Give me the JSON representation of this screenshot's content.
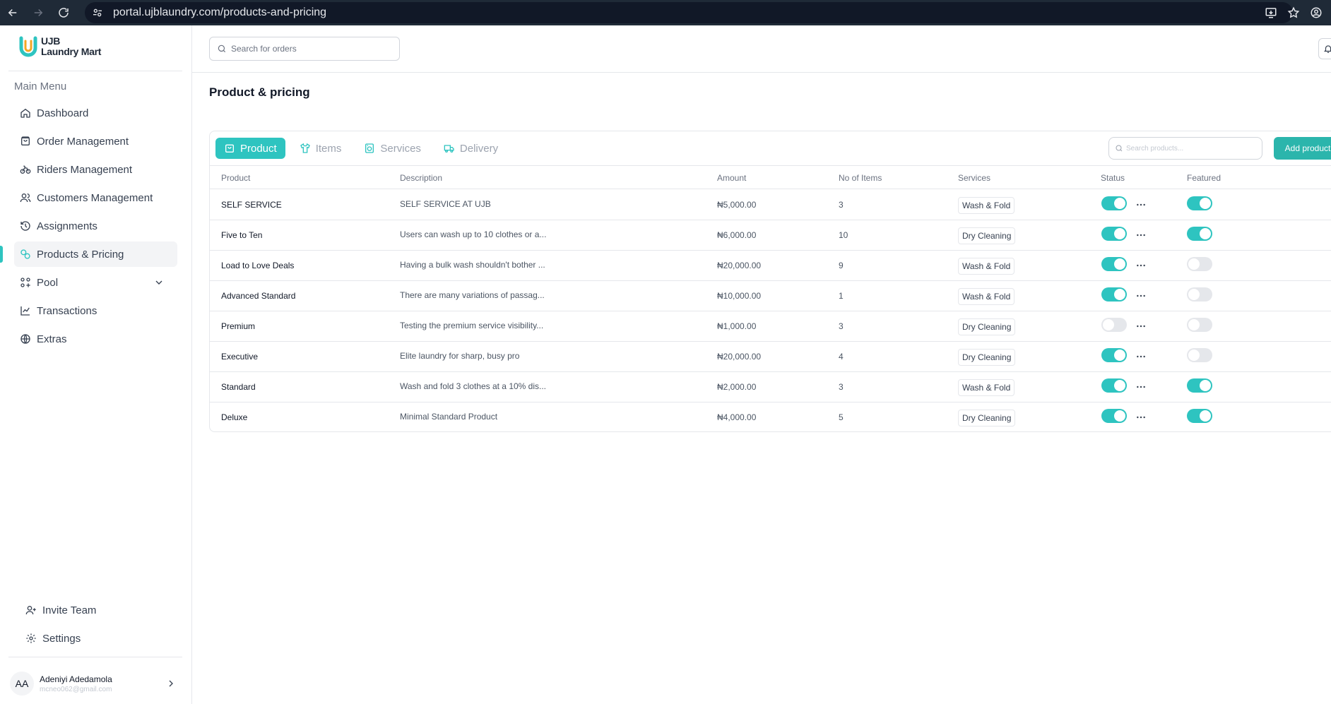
{
  "browser": {
    "url": "portal.ujblaundry.com/products-and-pricing"
  },
  "brand": {
    "line1": "UJB",
    "line2": "Laundry Mart",
    "accent": "#2ec4c0"
  },
  "sidebar": {
    "menu_title": "Main Menu",
    "items": [
      {
        "label": "Dashboard",
        "icon": "home-icon"
      },
      {
        "label": "Order Management",
        "icon": "bag-icon"
      },
      {
        "label": "Riders Management",
        "icon": "bike-icon"
      },
      {
        "label": "Customers Management",
        "icon": "users-icon"
      },
      {
        "label": "Assignments",
        "icon": "history-icon"
      },
      {
        "label": "Products & Pricing",
        "icon": "tag-icon",
        "active": true
      },
      {
        "label": "Pool",
        "icon": "pool-icon"
      },
      {
        "label": "Transactions",
        "icon": "chart-line-icon"
      },
      {
        "label": "Extras",
        "icon": "globe-icon"
      }
    ],
    "bottom": [
      {
        "label": "Invite Team",
        "icon": "user-plus-icon"
      },
      {
        "label": "Settings",
        "icon": "gear-icon"
      }
    ],
    "user": {
      "initials": "AA",
      "name": "Adeniyi Adedamola",
      "email": "mcneo062@gmail.com"
    }
  },
  "header": {
    "search_placeholder": "Search for orders"
  },
  "page": {
    "title": "Product & pricing"
  },
  "tabs": [
    {
      "label": "Product",
      "icon": "bag-icon",
      "active": true
    },
    {
      "label": "Items",
      "icon": "shirt-icon"
    },
    {
      "label": "Services",
      "icon": "washer-icon"
    },
    {
      "label": "Delivery",
      "icon": "truck-icon"
    }
  ],
  "toolbar": {
    "search_placeholder": "Search products...",
    "add_label": "Add product"
  },
  "table": {
    "columns": [
      "Product",
      "Description",
      "Amount",
      "No of Items",
      "Services",
      "Status",
      "Featured"
    ],
    "rows": [
      {
        "product": "SELF SERVICE",
        "description": "SELF SERVICE AT UJB",
        "amount": "₦5,000.00",
        "items": "3",
        "service": "Wash & Fold",
        "status": true,
        "featured": true
      },
      {
        "product": "Five to Ten",
        "description": "Users can wash up to 10 clothes or a...",
        "amount": "₦6,000.00",
        "items": "10",
        "service": "Dry Cleaning",
        "status": true,
        "featured": true
      },
      {
        "product": "Load to Love Deals",
        "description": "Having a bulk wash shouldn't bother ...",
        "amount": "₦20,000.00",
        "items": "9",
        "service": "Wash & Fold",
        "status": true,
        "featured": false
      },
      {
        "product": "Advanced Standard",
        "description": "There are many variations of passag...",
        "amount": "₦10,000.00",
        "items": "1",
        "service": "Wash & Fold",
        "status": true,
        "featured": false
      },
      {
        "product": "Premium",
        "description": "Testing the premium service visibility...",
        "amount": "₦1,000.00",
        "items": "3",
        "service": "Dry Cleaning",
        "status": false,
        "featured": false
      },
      {
        "product": "Executive",
        "description": "Elite laundry for sharp, busy pro",
        "amount": "₦20,000.00",
        "items": "4",
        "service": "Dry Cleaning",
        "status": true,
        "featured": false
      },
      {
        "product": "Standard",
        "description": "Wash and fold 3 clothes at a 10% dis...",
        "amount": "₦2,000.00",
        "items": "3",
        "service": "Wash & Fold",
        "status": true,
        "featured": true
      },
      {
        "product": "Deluxe",
        "description": "Minimal Standard Product",
        "amount": "₦4,000.00",
        "items": "5",
        "service": "Dry Cleaning",
        "status": true,
        "featured": true
      }
    ]
  }
}
